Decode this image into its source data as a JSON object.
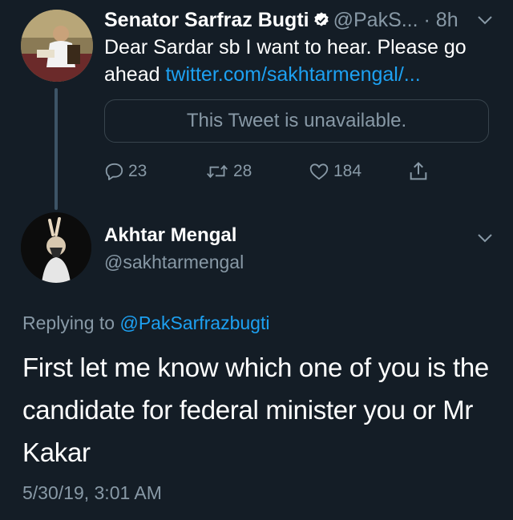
{
  "tweet1": {
    "name": "Senator Sarfraz Bugti",
    "handle_time": "@PakS... · 8h",
    "text": "Dear Sardar sb I want to hear. Please go ahead ",
    "link": "twitter.com/sakhtarmengal/...",
    "quoted_unavailable": "This Tweet is unavailable.",
    "reply_count": "23",
    "retweet_count": "28",
    "like_count": "184",
    "icons": [
      "verified-badge-icon",
      "chevron-down-icon",
      "reply-icon",
      "retweet-icon",
      "like-icon",
      "share-icon"
    ]
  },
  "tweet2": {
    "name": "Akhtar Mengal",
    "handle": "@sakhtarmengal",
    "replying_prefix": "Replying to ",
    "replying_handle": "@PakSarfrazbugti",
    "text": "First let me know which one of you is the candidate for federal minister you or Mr Kakar",
    "timestamp": "5/30/19, 3:01 AM"
  },
  "colors": {
    "background": "#141d26",
    "secondary_text": "#8899a6",
    "link": "#1da1f2",
    "border": "#38444d"
  }
}
